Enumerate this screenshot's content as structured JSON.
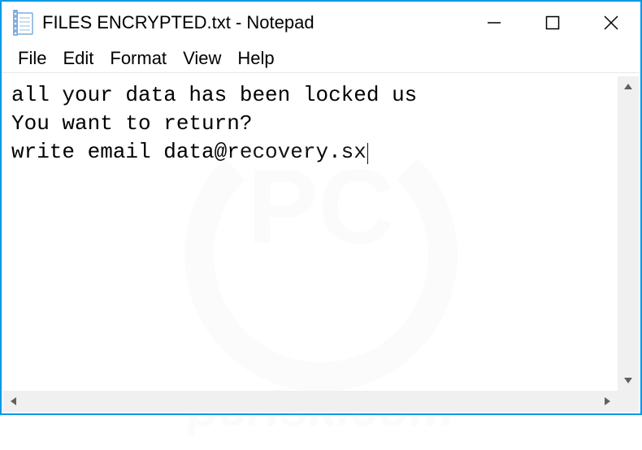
{
  "titlebar": {
    "title": "FILES ENCRYPTED.txt - Notepad"
  },
  "menubar": {
    "items": [
      "File",
      "Edit",
      "Format",
      "View",
      "Help"
    ]
  },
  "editor": {
    "content": "all your data has been locked us\nYou want to return?\nwrite email data@recovery.sx"
  },
  "watermark": {
    "line1": "pcrisk.com"
  }
}
